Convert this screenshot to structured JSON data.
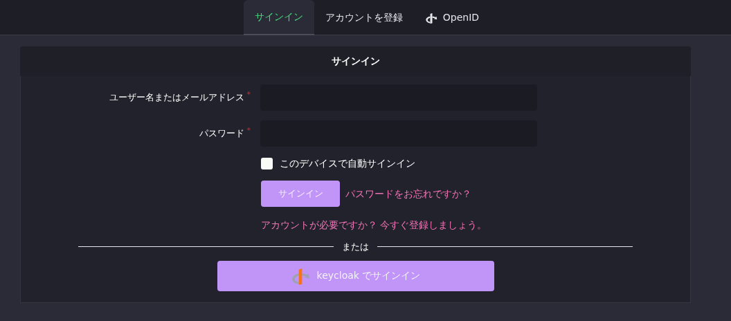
{
  "tabs": [
    {
      "label": "サインイン",
      "selected": true
    },
    {
      "label": "アカウントを登録",
      "selected": false
    },
    {
      "label": "OpenID",
      "selected": false,
      "kind": "openid"
    }
  ],
  "card": {
    "title": "サインイン",
    "fields": [
      {
        "label": "ユーザー名またはメールアドレス",
        "required_mark": "*"
      },
      {
        "label": "パスワード",
        "required_mark": "*"
      }
    ],
    "remember": {
      "label": "このデバイスで自動サインイン",
      "checked": false
    },
    "submit": "サインイン",
    "forgot_link": "パスワードをお忘れですか？",
    "register_link": "アカウントが必要ですか？ 今すぐ登録しましょう。",
    "divider": "または",
    "sso_button": "keycloak でサインイン"
  }
}
